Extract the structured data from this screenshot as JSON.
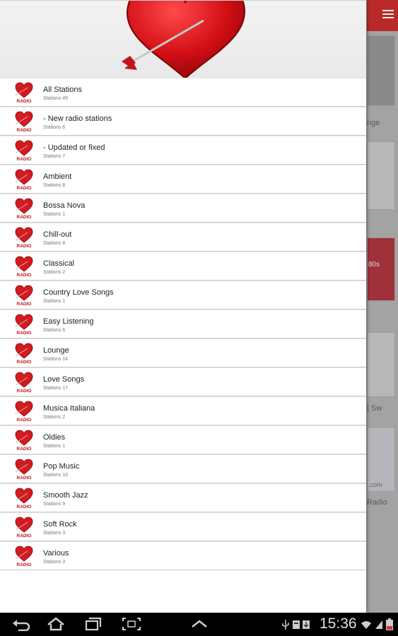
{
  "background_app": {
    "fragments": [
      "nge",
      "| Sw",
      ".com",
      "Radio",
      "80s"
    ]
  },
  "stations": [
    {
      "label": "All Stations",
      "sub": "Stations 49"
    },
    {
      "label": "- New radio stations",
      "sub": "Stations 6"
    },
    {
      "label": "- Updated or fixed",
      "sub": "Stations 7"
    },
    {
      "label": "Ambient",
      "sub": "Stations 8"
    },
    {
      "label": "Bossa Nova",
      "sub": "Stations 1"
    },
    {
      "label": "Chill-out",
      "sub": "Stations 8"
    },
    {
      "label": "Classical",
      "sub": "Stations 2"
    },
    {
      "label": "Country Love Songs",
      "sub": "Stations 1"
    },
    {
      "label": "Easy Listening",
      "sub": "Stations 6"
    },
    {
      "label": "Lounge",
      "sub": "Stations 14"
    },
    {
      "label": "Love Songs",
      "sub": "Stations 17"
    },
    {
      "label": "Musica Italiana",
      "sub": "Stations 2"
    },
    {
      "label": "Oldies",
      "sub": "Stations 1"
    },
    {
      "label": "Pop Music",
      "sub": "Stations 10"
    },
    {
      "label": "Smooth Jazz",
      "sub": "Stations 9"
    },
    {
      "label": "Soft Rock",
      "sub": "Stations 3"
    },
    {
      "label": "Various",
      "sub": "Stations 3"
    }
  ],
  "icon_label": "RADIO",
  "status_bar": {
    "time": "15:36"
  },
  "colors": {
    "accent": "#c0161b",
    "topbar": "#b82a2a"
  }
}
